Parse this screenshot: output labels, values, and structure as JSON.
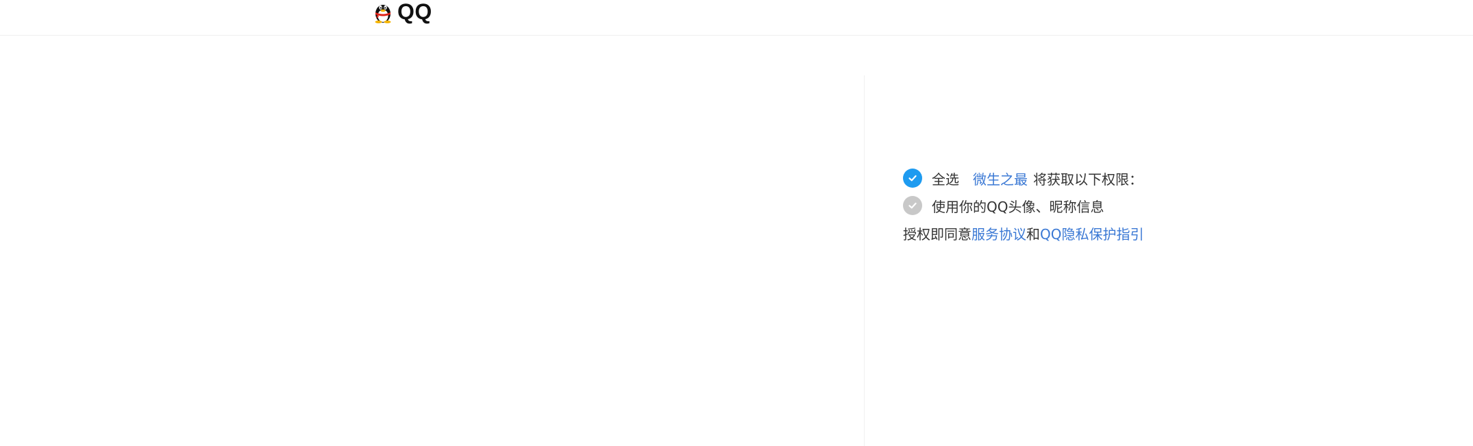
{
  "header": {
    "brand": "QQ"
  },
  "auth": {
    "select_all_label": "全选",
    "app_name": "微生之最",
    "permission_intro": "将获取以下权限：",
    "permissions": [
      {
        "label": "使用你的QQ头像、昵称信息"
      }
    ],
    "agreement": {
      "prefix": "授权即同意",
      "service_link": "服务协议",
      "conjunction": "和",
      "privacy_link": "QQ隐私保护指引"
    }
  },
  "colors": {
    "accent": "#1e9bf0",
    "link": "#3a78d4",
    "disabled_check": "#c8c8c8"
  }
}
